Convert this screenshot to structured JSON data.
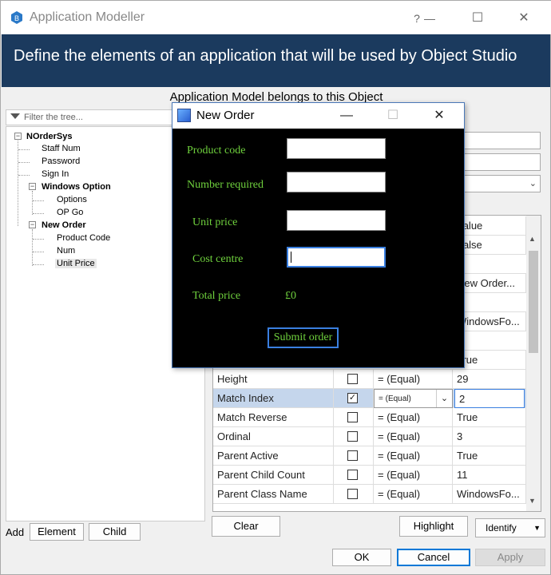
{
  "window": {
    "title": "Application Modeller",
    "help": "?",
    "minimize": "—",
    "maximize": "☐",
    "close": "✕"
  },
  "banner": "Define the elements of an application that will be used by Object Studio",
  "belongs": "Application Model belongs to this Object",
  "filter_placeholder": "Filter the tree...",
  "tree": {
    "root": "NOrderSys",
    "items": [
      {
        "label": "Staff Num"
      },
      {
        "label": "Password"
      },
      {
        "label": "Sign In"
      },
      {
        "label": "Windows Option",
        "children": [
          "Options",
          "OP Go"
        ]
      },
      {
        "label": "New Order",
        "children": [
          "Product Code",
          "Num",
          "Unit Price"
        ]
      }
    ]
  },
  "add": {
    "label": "Add",
    "element": "Element",
    "child": "Child"
  },
  "grid": {
    "partial_values": [
      "Value",
      "False",
      "New Order...",
      "WindowsFo...",
      "True"
    ],
    "rows": [
      {
        "name": "Height",
        "checked": false,
        "op": "=  (Equal)",
        "value": "29"
      },
      {
        "name": "Match Index",
        "checked": true,
        "op": "=  (Equal)",
        "value": "2"
      },
      {
        "name": "Match Reverse",
        "checked": false,
        "op": "=  (Equal)",
        "value": "True"
      },
      {
        "name": "Ordinal",
        "checked": false,
        "op": "=  (Equal)",
        "value": "3"
      },
      {
        "name": "Parent Active",
        "checked": false,
        "op": "=  (Equal)",
        "value": "True"
      },
      {
        "name": "Parent Child Count",
        "checked": false,
        "op": "=  (Equal)",
        "value": "11"
      },
      {
        "name": "Parent Class Name",
        "checked": false,
        "op": "=  (Equal)",
        "value": "WindowsFo..."
      }
    ]
  },
  "buttons": {
    "clear": "Clear",
    "highlight": "Highlight",
    "identify": "Identify",
    "ok": "OK",
    "cancel": "Cancel",
    "apply": "Apply"
  },
  "order_form": {
    "title": "New Order",
    "product_code": "Product code",
    "number_required": "Number required",
    "unit_price": "Unit price",
    "cost_centre": "Cost centre",
    "total_price": "Total price",
    "total_value": "£0",
    "submit": "Submit order"
  },
  "colors": {
    "banner": "#1b3a5e",
    "form_text": "#6fd13d",
    "selected_row": "#c5d6ec"
  }
}
